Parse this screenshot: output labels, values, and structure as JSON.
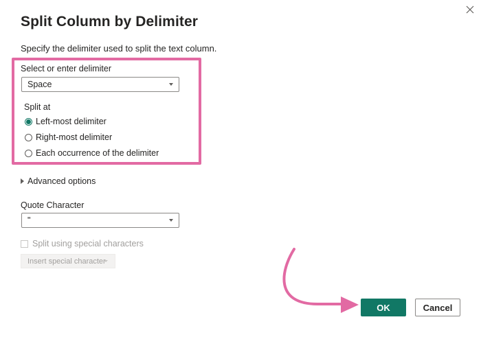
{
  "dialog": {
    "title": "Split Column by Delimiter",
    "description": "Specify the delimiter used to split the text column.",
    "close_icon": "close-icon"
  },
  "delimiter": {
    "label": "Select or enter delimiter",
    "value": "Space"
  },
  "split_at": {
    "label": "Split at",
    "options": [
      {
        "label": "Left-most delimiter",
        "checked": true
      },
      {
        "label": "Right-most delimiter",
        "checked": false
      },
      {
        "label": "Each occurrence of the delimiter",
        "checked": false
      }
    ]
  },
  "advanced": {
    "label": "Advanced options"
  },
  "quote": {
    "label": "Quote Character",
    "value": "\""
  },
  "special": {
    "checkbox_label": "Split using special characters",
    "insert_label": "Insert special character"
  },
  "buttons": {
    "ok": "OK",
    "cancel": "Cancel"
  },
  "colors": {
    "accent": "#117865",
    "annotation": "#e26aa3"
  }
}
